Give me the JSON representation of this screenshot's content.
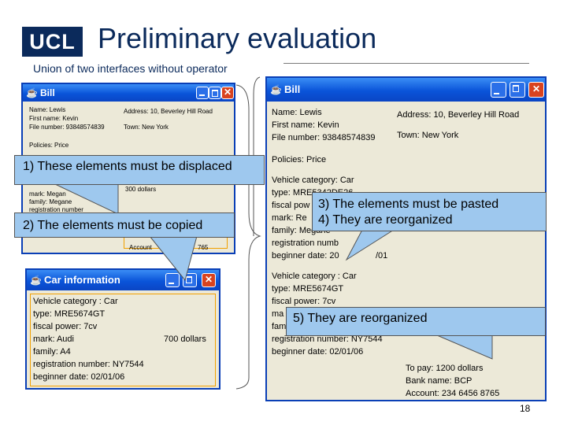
{
  "slide": {
    "logo": "UCL",
    "title": "Preliminary evaluation",
    "subtitle": "Union of two interfaces without operator",
    "number": "18"
  },
  "left_bill": {
    "title": "Bill",
    "name": "Name: Lewis",
    "first_name": "First name: Kevin",
    "file_number": "File number: 93848574839",
    "address": "Address:  10, Beverley Hill Road",
    "town": "Town: New York",
    "policies": "Policies: Price",
    "mark": "mark: Megan",
    "family": "family: Megane",
    "registration": "registration number",
    "amount": "300 dollars",
    "account": "Account",
    "account_end": "765"
  },
  "car_info": {
    "title": "Car information",
    "vehicle_category": "Vehicle category : Car",
    "type": "type: MRE5674GT",
    "fiscal_power": "fiscal power: 7cv",
    "mark": "mark: Audi",
    "amount": "700 dollars",
    "family": "family: A4",
    "registration": "registration number: NY7544",
    "beginner_date": "beginner date: 02/01/06"
  },
  "right_bill": {
    "title": "Bill",
    "name": "Name: Lewis",
    "first_name": "First name: Kevin",
    "file_number": "File number: 93848574839",
    "address": "Address:  10, Beverley Hill Road",
    "town": "Town: New York",
    "policies": "Policies: Price",
    "vehicle1": {
      "category": "Vehicle category: Car",
      "type": "type: MRE5342DE26",
      "fiscal": "fiscal pow",
      "mark": "mark: Re",
      "family": "family: Megane",
      "registration": "registration numb",
      "beginner_date": "beginner date: 20",
      "beginner_date_end": "/01"
    },
    "vehicle2": {
      "category": "Vehicle category : Car",
      "type": "type: MRE5674GT",
      "fiscal": "fiscal power: 7cv",
      "mark": "ma",
      "family": "fam",
      "registration": "registration number: NY7544",
      "beginner_date": "beginner date: 02/01/06"
    },
    "to_pay": "To pay: 1200 dollars",
    "bank_name": "Bank name: BCP",
    "account": "Account: 234 6456 8765"
  },
  "callouts": {
    "c1": "1) These elements must be displaced",
    "c2": "2) The elements must be copied",
    "c3": "3) The elements must be pasted",
    "c4": "4) They are reorganized",
    "c5": "5) They are reorganized"
  },
  "colors": {
    "titlebar": "#0a54d9",
    "window_bg": "#ece9d8",
    "callout_bg": "#9ec8ee",
    "ucl_navy": "#0b2a5b"
  },
  "icons": [
    "app-icon",
    "minimize-icon",
    "maximize-icon",
    "close-icon"
  ]
}
